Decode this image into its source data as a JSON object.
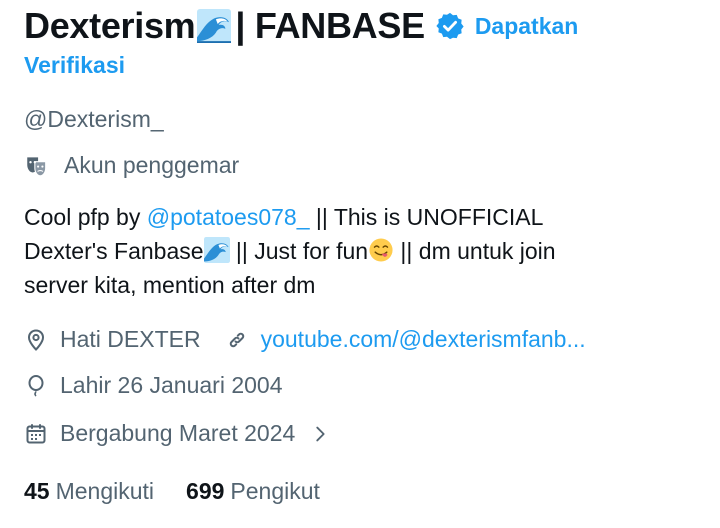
{
  "profile": {
    "display_name_part1": "Dexterism",
    "display_name_part2": "| FANBASE",
    "verify_link_line1": "Dapatkan",
    "verify_link_line2": "Verifikasi",
    "handle": "@Dexterism_",
    "category": "Akun penggemar",
    "bio": {
      "line1_prefix": "Cool pfp by ",
      "mention": "@potatoes078_",
      "line1_suffix": " || This is UNOFFICIAL",
      "line2_prefix": "Dexter's Fanbase",
      "line2_mid": " || Just for fun",
      "line2_suffix": " || dm untuk join",
      "line3": "server kita, mention after dm"
    },
    "location": "Hati DEXTER",
    "website": "youtube.com/@dexterismfanb...",
    "birthdate": "Lahir 26 Januari 2004",
    "joined": "Bergabung Maret 2024",
    "following_count": "45",
    "following_label": "Mengikuti",
    "followers_count": "699",
    "followers_label": "Pengikut"
  },
  "colors": {
    "text": "#0f1419",
    "secondary": "#536471",
    "link": "#1d9bf0"
  },
  "icons": {
    "wave": "water-wave-emoji-icon",
    "verified": "verified-badge-icon",
    "category": "theater-masks-icon",
    "location": "location-pin-icon",
    "website": "link-icon",
    "birthdate": "balloon-icon",
    "joined": "calendar-icon",
    "chevron": "chevron-right-icon",
    "yum": "yum-face-emoji-icon"
  }
}
